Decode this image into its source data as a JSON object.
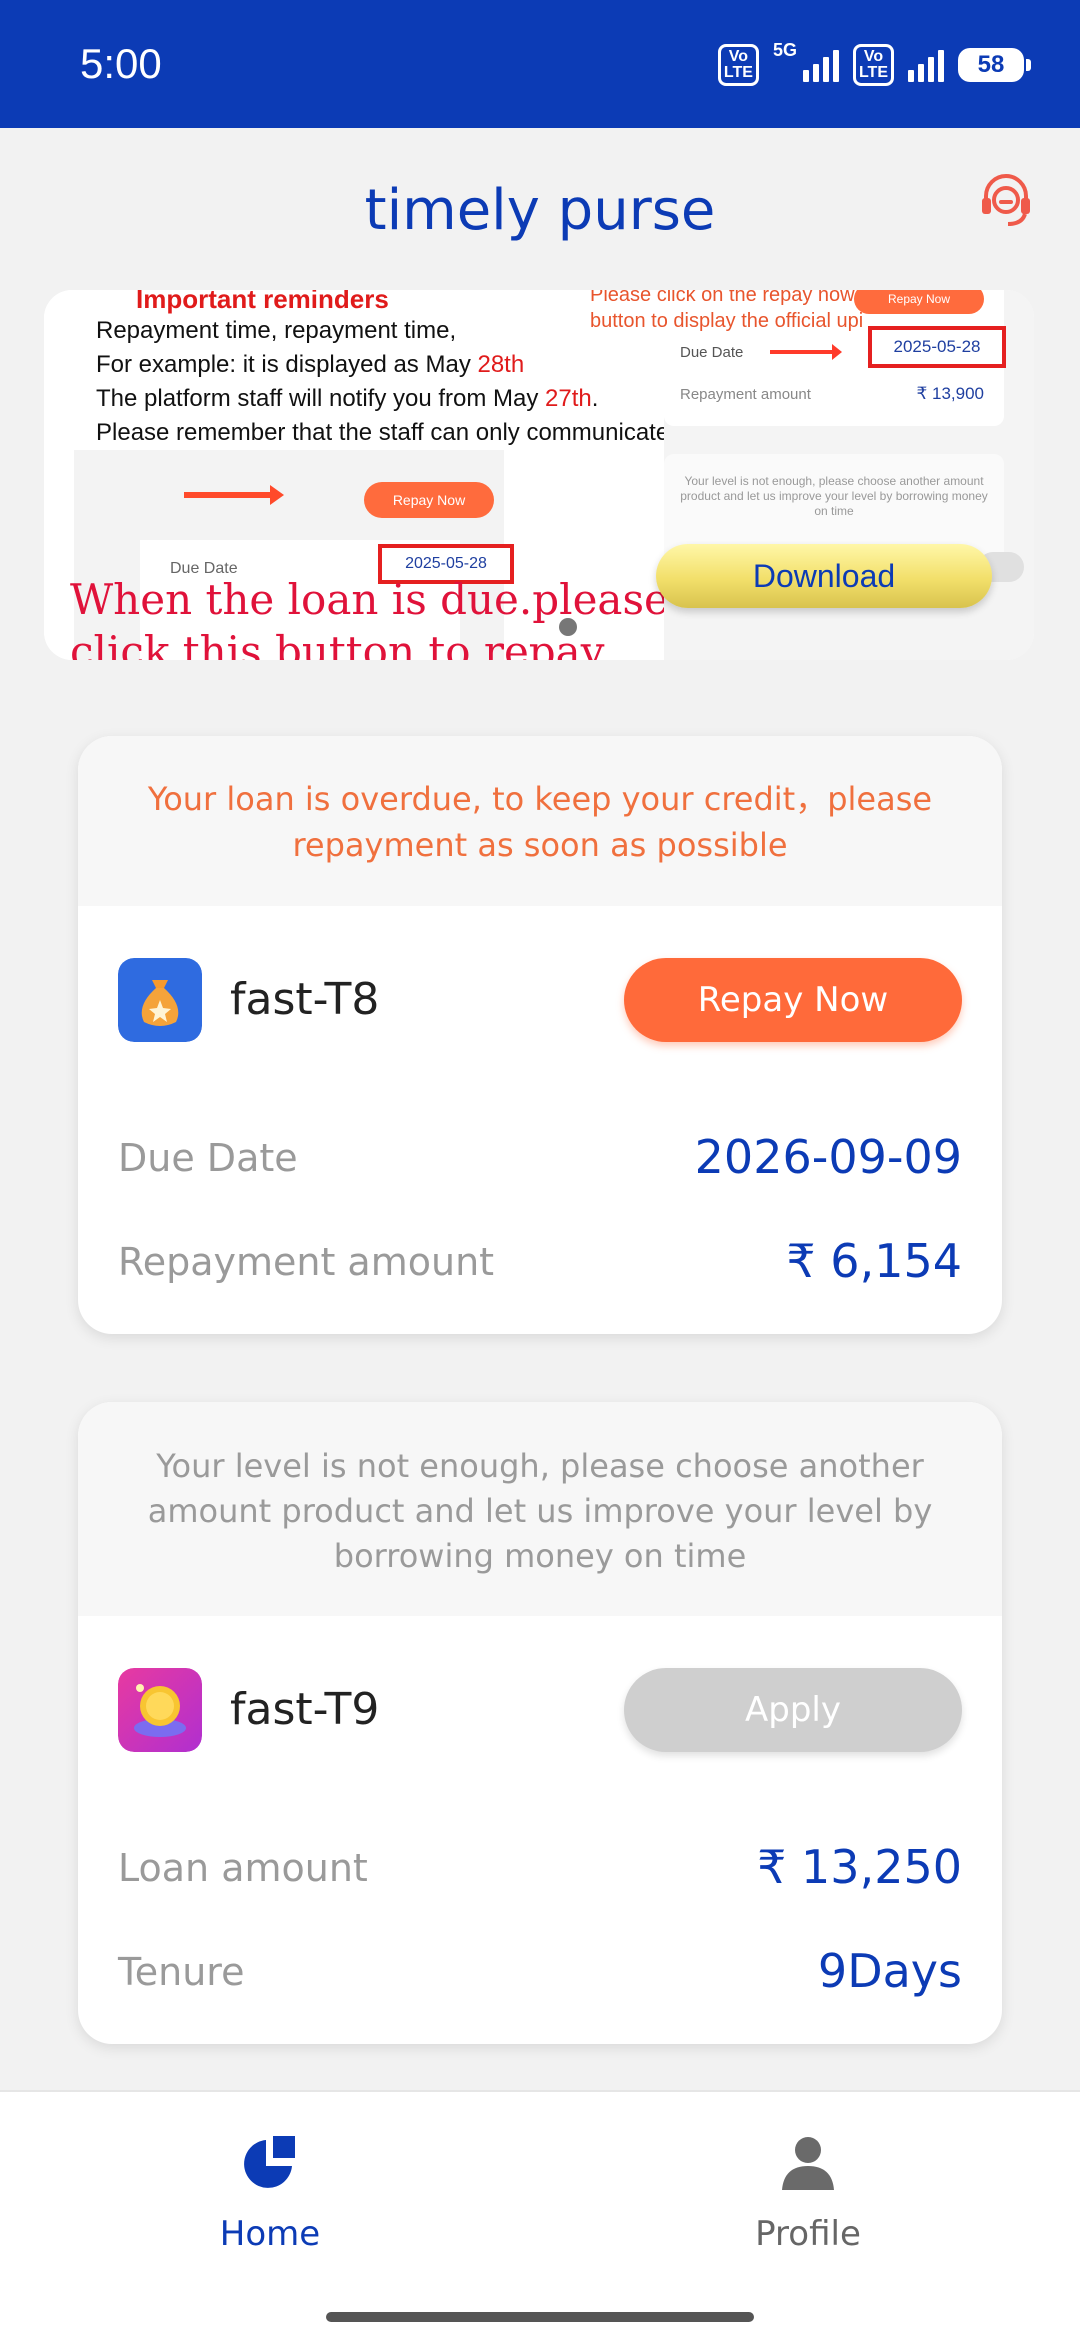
{
  "status_bar": {
    "time": "5:00",
    "volte1": "Vo\nLTE",
    "net_type": "5G",
    "volte2": "Vo\nLTE",
    "battery": "58"
  },
  "header": {
    "title": "timely purse",
    "support_icon": "headset-icon"
  },
  "banner": {
    "reminder_title": "Important reminders",
    "lines": [
      "Repayment time, repayment time,",
      "For example: it is displayed as May ",
      "28th",
      "The platform staff will notify you from May ",
      "27th",
      ".",
      "Please remember that the staff can only communicate with you one day in advance"
    ],
    "mini_repay_label": "Repay Now",
    "mini_due_label": "Due Date",
    "mini_due_date": "2025-05-28",
    "big_red_text": "When the loan is due.please click this button to repay",
    "upi_note_1": "Please click on the repay now",
    "upi_note_2": "button to display the official upi",
    "upi_repay_label": "Repay Now",
    "upi_due_label": "Due Date",
    "upi_due_date": "2025-05-28",
    "upi_amount_label": "Repayment amount",
    "upi_amount": "₹ 13,900",
    "level_text": "Your level is not enough, please choose another amount product and let us improve your level by borrowing money on time",
    "download_label": "Download"
  },
  "cards": [
    {
      "notice": "Your loan is overdue, to keep your credit，please repayment as soon as possible",
      "product": "fast-T8",
      "button": "Repay Now",
      "rows": [
        {
          "label": "Due Date",
          "value": "2026-09-09"
        },
        {
          "label": "Repayment amount",
          "value": "₹ 6,154"
        }
      ]
    },
    {
      "notice": "Your level is not enough, please choose another amount product and let us improve your level by borrowing money on time",
      "product": "fast-T9",
      "button": "Apply",
      "rows": [
        {
          "label": "Loan amount",
          "value": "₹ 13,250"
        },
        {
          "label": "Tenure",
          "value": "9Days"
        }
      ]
    }
  ],
  "nav": {
    "home_label": "Home",
    "home_icon": "pie-chart-icon",
    "profile_label": "Profile",
    "profile_icon": "person-icon"
  },
  "colors": {
    "brand_blue": "#0c3bb5",
    "accent_orange": "#ff6a3a",
    "disabled_gray": "#cfcfcf"
  }
}
